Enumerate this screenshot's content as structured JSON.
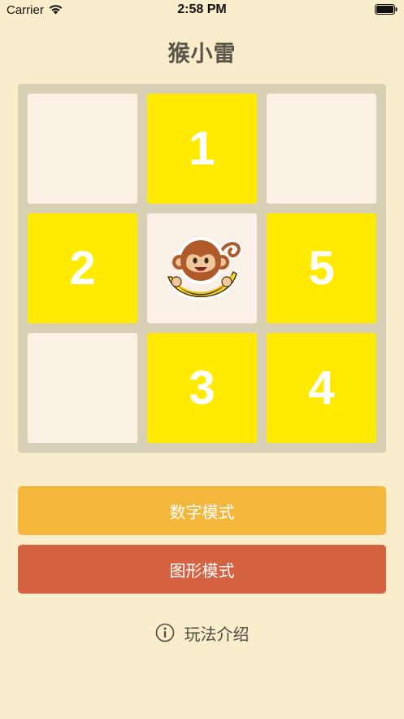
{
  "status": {
    "carrier": "Carrier",
    "time": "2:58 PM"
  },
  "title": "猴小雷",
  "board": {
    "tiles": [
      {
        "value": "",
        "type": "empty"
      },
      {
        "value": "1",
        "type": "number"
      },
      {
        "value": "",
        "type": "empty"
      },
      {
        "value": "2",
        "type": "number"
      },
      {
        "value": "",
        "type": "monkey"
      },
      {
        "value": "5",
        "type": "number"
      },
      {
        "value": "",
        "type": "empty"
      },
      {
        "value": "3",
        "type": "number"
      },
      {
        "value": "4",
        "type": "number"
      }
    ]
  },
  "buttons": {
    "number_mode": "数字模式",
    "image_mode": "图形模式"
  },
  "help": {
    "label": "玩法介绍"
  },
  "colors": {
    "background": "#f9edcc",
    "board": "#d8d0b4",
    "tile_number": "#ffea00",
    "tile_empty": "#fbf2e6",
    "number_mode_button": "#f3b73c",
    "image_mode_button": "#d56240"
  }
}
